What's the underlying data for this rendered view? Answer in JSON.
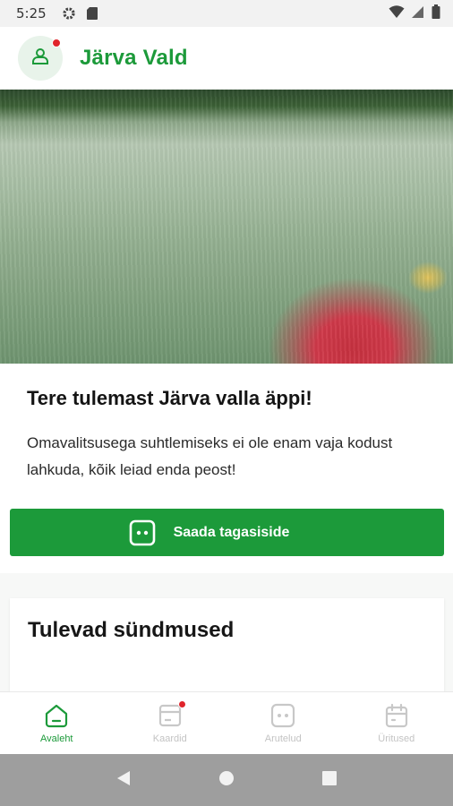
{
  "status": {
    "time": "5:25"
  },
  "app": {
    "title": "Järva Vald"
  },
  "welcome": {
    "title": "Tere tulemast Järva valla äppi!",
    "text": "Omavalitsusega suhtlemiseks ei ole enam vaja kodust lahkuda, kõik leiad enda peost!"
  },
  "feedback": {
    "label": "Saada tagasiside"
  },
  "events": {
    "title": "Tulevad sündmused"
  },
  "nav": [
    {
      "label": "Avaleht",
      "icon": "home-icon"
    },
    {
      "label": "Kaardid",
      "icon": "card-icon"
    },
    {
      "label": "Arutelud",
      "icon": "chat-icon"
    },
    {
      "label": "Üritused",
      "icon": "calendar-icon"
    }
  ],
  "colors": {
    "brand": "#1c9a3a",
    "badge": "#e0242b"
  }
}
